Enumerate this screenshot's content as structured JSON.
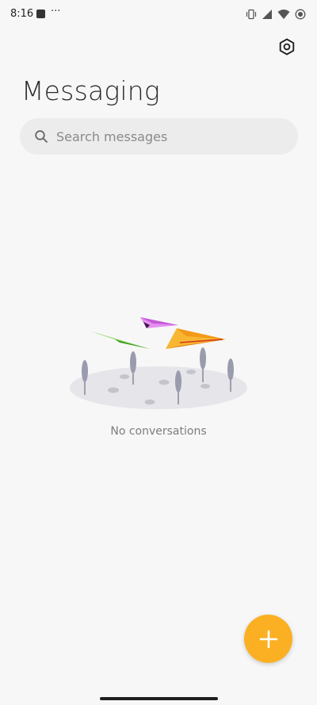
{
  "status_bar": {
    "time": "8:16",
    "notification_overflow": "···",
    "icons": [
      "notification-square-icon",
      "vibrate-icon",
      "cellular-signal-icon",
      "wifi-icon",
      "battery-icon"
    ]
  },
  "header": {
    "title": "Messaging",
    "settings_icon": "settings-hexagon-icon"
  },
  "search": {
    "placeholder": "Search messages",
    "value": "",
    "icon": "search-icon"
  },
  "empty_state": {
    "illustration": "paper-planes-illustration",
    "message": "No conversations"
  },
  "fab": {
    "icon": "plus-icon",
    "color": "#fbb023"
  },
  "colors": {
    "background": "#f7f7f7",
    "search_background": "#ececec",
    "accent": "#fbb023",
    "plane_green": "#58c82c",
    "plane_purple": "#d879e8",
    "plane_orange": "#f5a41c"
  }
}
